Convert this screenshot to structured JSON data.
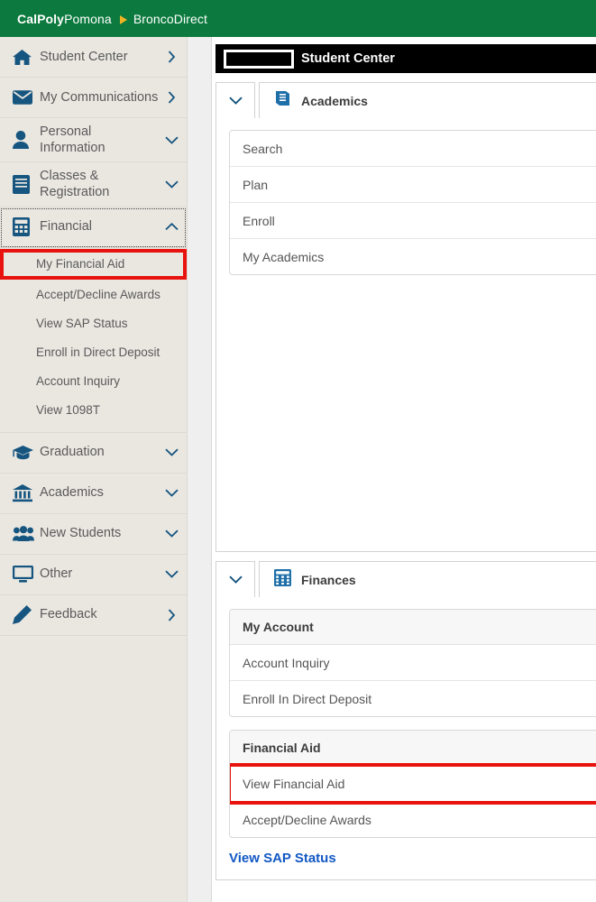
{
  "brand": {
    "name_bold": "CalPoly",
    "name_rest": "Pomona",
    "separator_icon": "triangle-right-icon",
    "app": "BroncoDirect",
    "bar_color": "#0C7A3E",
    "accent_color": "#F0B323"
  },
  "sidebar": {
    "items": [
      {
        "label": "Student Center",
        "icon": "home-icon",
        "chevron": "chevron-right",
        "expanded": false
      },
      {
        "label": "My Communications",
        "icon": "envelope-icon",
        "chevron": "chevron-right",
        "expanded": false
      },
      {
        "label": "Personal Information",
        "icon": "person-icon",
        "chevron": "chevron-down",
        "expanded": false
      },
      {
        "label": "Classes & Registration",
        "icon": "book-icon",
        "chevron": "chevron-down",
        "expanded": false
      },
      {
        "label": "Financial",
        "icon": "calculator-icon",
        "chevron": "chevron-up",
        "expanded": true
      },
      {
        "label": "Graduation",
        "icon": "graduation-cap-icon",
        "chevron": "chevron-down",
        "expanded": false
      },
      {
        "label": "Academics",
        "icon": "bank-icon",
        "chevron": "chevron-down",
        "expanded": false
      },
      {
        "label": "New Students",
        "icon": "people-icon",
        "chevron": "chevron-down",
        "expanded": false
      },
      {
        "label": "Other",
        "icon": "monitor-icon",
        "chevron": "chevron-down",
        "expanded": false
      },
      {
        "label": "Feedback",
        "icon": "pencil-icon",
        "chevron": "chevron-right",
        "expanded": false
      }
    ],
    "financial_subitems": [
      {
        "label": "My Financial Aid",
        "highlighted": true
      },
      {
        "label": "Accept/Decline Awards",
        "highlighted": false
      },
      {
        "label": "View SAP Status",
        "highlighted": false
      },
      {
        "label": "Enroll in Direct Deposit",
        "highlighted": false
      },
      {
        "label": "Account Inquiry",
        "highlighted": false
      },
      {
        "label": "View 1098T",
        "highlighted": false
      }
    ],
    "highlight_color": "#E8130E"
  },
  "page": {
    "redacted_name": "",
    "title": "Student Center"
  },
  "academics": {
    "icon": "book-icon",
    "title": "Academics",
    "toggle_icon": "chevron-down-icon",
    "links": [
      {
        "label": "Search"
      },
      {
        "label": "Plan"
      },
      {
        "label": "Enroll"
      },
      {
        "label": "My Academics"
      }
    ]
  },
  "finances": {
    "icon": "calculator-icon",
    "title": "Finances",
    "toggle_icon": "chevron-down-icon",
    "my_account": {
      "header": "My Account",
      "links": [
        {
          "label": "Account Inquiry"
        },
        {
          "label": "Enroll In Direct Deposit"
        }
      ]
    },
    "financial_aid": {
      "header": "Financial Aid",
      "links": [
        {
          "label": "View Financial Aid",
          "highlighted": true
        },
        {
          "label": "Accept/Decline Awards",
          "highlighted": false
        }
      ]
    },
    "sap_link": "View SAP Status"
  }
}
